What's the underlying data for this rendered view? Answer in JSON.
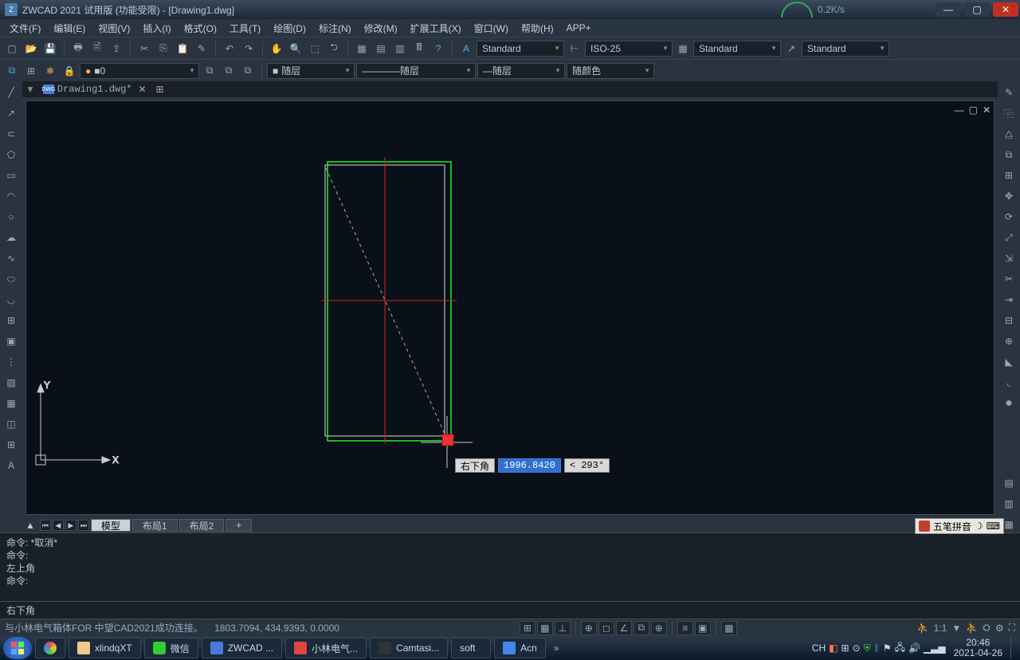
{
  "title": "ZWCAD 2021 试用版 (功能受限) - [Drawing1.dwg]",
  "net_speed": "0.2K/s",
  "menu": [
    "文件(F)",
    "编辑(E)",
    "视图(V)",
    "插入(I)",
    "格式(O)",
    "工具(T)",
    "绘图(D)",
    "标注(N)",
    "修改(M)",
    "扩展工具(X)",
    "窗口(W)",
    "帮助(H)",
    "APP+"
  ],
  "styles": {
    "text": "Standard",
    "dim": "ISO-25",
    "table": "Standard",
    "mleader": "Standard"
  },
  "layer": {
    "current": "0",
    "suilayer": "随层",
    "linetype": "随层",
    "lineweight": "随层",
    "plotcolor": "随颜色"
  },
  "doc": {
    "name": "Drawing1.dwg*"
  },
  "dyn": {
    "prompt": "右下角",
    "value": "1996.8420",
    "angle": "< 293°"
  },
  "tabs": {
    "model": "模型",
    "layout1": "布局1",
    "layout2": "布局2"
  },
  "cmdlog": {
    "l1": "命令: *取消*",
    "l2": "命令:",
    "l3": "左上角",
    "l4": "命令:"
  },
  "cmd_current": "右下角",
  "status": {
    "msg": "与小林电气箱体FOR 中望CAD2021成功连接。",
    "coords": "1803.7094, 434.9393, 0.0000",
    "scale": "1:1"
  },
  "ime": "五笔拼音",
  "tasks": {
    "folder": "xlindqXT",
    "wechat": "微信",
    "zwcad": "ZWCAD ...",
    "xiaolin": "小林电气...",
    "camtasia": "Camtasi...",
    "soft": "soft",
    "acn": "Acn"
  },
  "clock": {
    "time": "20:46",
    "date": "2021-04-26"
  }
}
